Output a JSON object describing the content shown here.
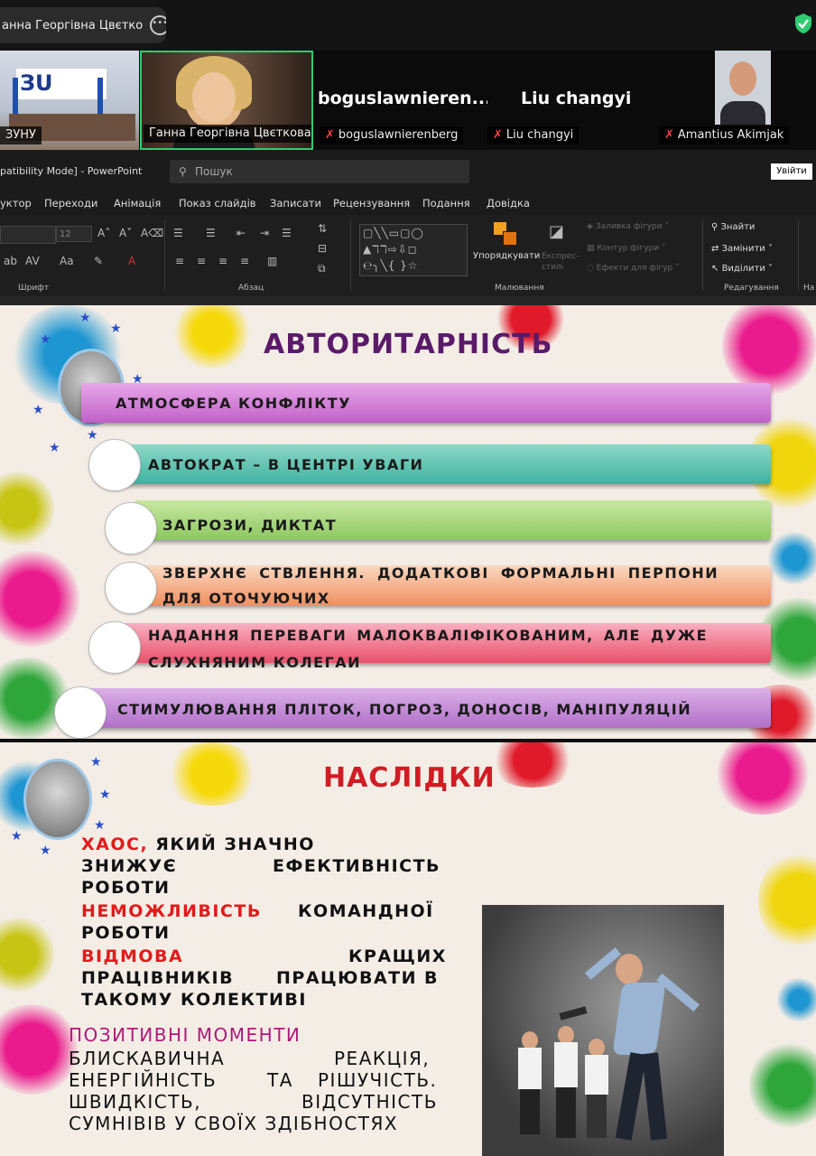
{
  "meeting": {
    "speaker_pill": "анна Георгівна Цвєтко",
    "participants": [
      {
        "label": "ЗУНУ"
      },
      {
        "label": "Ганна Георгівна Цвєткова"
      },
      {
        "big_name": "boguslawnieren...",
        "label": "boguslawnierenberg"
      },
      {
        "big_name": "Liu changyi",
        "label": "Liu changyi"
      },
      {
        "label": "Amantius Akimjak"
      }
    ]
  },
  "powerpoint": {
    "title": "patibility Mode] - PowerPoint",
    "search_placeholder": "Пошук",
    "signin": "Увійти",
    "tabs": [
      "уктор",
      "Переходи",
      "Анімація",
      "Показ слайдів",
      "Записати",
      "Рецензування",
      "Подання",
      "Довідка"
    ],
    "font_size": "12",
    "groups": {
      "font": "Шрифт",
      "paragraph": "Абзац",
      "drawing": "Малювання",
      "editing": "Редагування",
      "na": "На"
    },
    "arrange": "Упорядкувати",
    "quick_styles": "Експрес-стилі",
    "shape_fill": "Заливка фігури",
    "shape_outline": "Контур фігури",
    "shape_effects": "Ефекти для фігур",
    "find": "Знайти",
    "replace": "Замінити",
    "select": "Виділити"
  },
  "slide1": {
    "title": "АВТОРИТАРНІСТЬ",
    "items": [
      "АТМОСФЕРА КОНФЛІКТУ",
      "АВТОКРАТ – В ЦЕНТРІ УВАГИ",
      "ЗАГРОЗИ, ДИКТАТ",
      "ЗВЕРХНЄ СТВЛЕННЯ. ДОДАТКОВІ ФОРМАЛЬНІ ПЕРПОНИ",
      "ДЛЯ ОТОЧУЮЧИХ",
      "НАДАННЯ ПЕРЕВАГИ МАЛОКВАЛІФІКОВАНИМ, АЛЕ ДУЖЕ",
      "СЛУХНЯНИМ КОЛЕГАИ",
      "СТИМУЛЮВАННЯ ПЛІТОК, ПОГРОЗ, ДОНОСІВ, МАНІПУЛЯЦІЙ"
    ]
  },
  "slide2": {
    "title": "НАСЛІДКИ",
    "l1a": "ХАОС,",
    "l1b": " ЯКИЙ ЗНАЧНО",
    "l2a": "ЗНИЖУЄ",
    "l2b": "ЕФЕКТИВНІСТЬ",
    "l3": "РОБОТИ",
    "l4a": "НЕМОЖЛИВІСТЬ",
    "l4b": "КОМАНДНОЇ",
    "l5": "РОБОТИ",
    "l6a": "ВІДМОВА",
    "l6b": "КРАЩИХ",
    "l7a": "ПРАЦІВНИКІВ",
    "l7b": "ПРАЦЮВАТИ",
    "l7c": "В",
    "l8": "ТАКОМУ КОЛЕКТИВІ",
    "positive": "ПОЗИТИВНІ МОМЕНТИ",
    "p1a": "БЛИСКАВИЧНА",
    "p1b": "РЕАКЦІЯ,",
    "p2a": "ЕНЕРГІЙНІСТЬ",
    "p2b": "ТА",
    "p2c": "РІШУЧІСТЬ.",
    "p3a": "ШВИДКІСТЬ,",
    "p3b": "ВІДСУТНІСТЬ",
    "p4": "СУМНІВІВ У СВОЇХ ЗДІБНОСТЯХ"
  },
  "colors": {
    "accent_green": "#2ecc71",
    "title_purple": "#5a1a6a",
    "title_red": "#d01c24"
  }
}
